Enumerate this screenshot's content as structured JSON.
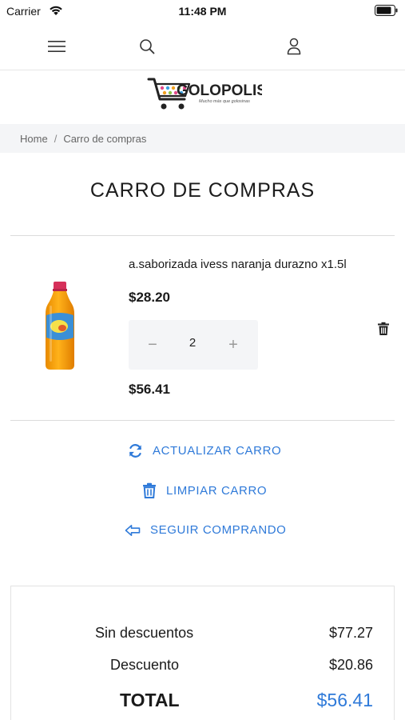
{
  "status_bar": {
    "carrier": "Carrier",
    "time": "11:48 PM"
  },
  "nav": {
    "menu_icon": "hamburger-menu-icon",
    "search_icon": "search-icon",
    "user_icon": "user-icon"
  },
  "brand": {
    "name": "GOLOPOLIS",
    "tagline": "Mucho más que golosinas"
  },
  "breadcrumb": {
    "home": "Home",
    "separator": "/",
    "current": "Carro de compras"
  },
  "page": {
    "title": "CARRO DE COMPRAS"
  },
  "cart_items": [
    {
      "name": "a.saborizada ivess naranja durazno x1.5l",
      "price": "$28.20",
      "quantity": "2",
      "minus": "−",
      "plus": "+",
      "subtotal": "$56.41"
    }
  ],
  "actions": {
    "update_cart": "ACTUALIZAR CARRO",
    "clear_cart": "LIMPIAR CARRO",
    "continue_shopping": "SEGUIR COMPRANDO"
  },
  "totals": {
    "without_discount_label": "Sin descuentos",
    "without_discount_value": "$77.27",
    "discount_label": "Descuento",
    "discount_value": "$20.86",
    "total_label": "TOTAL",
    "total_value": "$56.41"
  },
  "colors": {
    "accent": "#2f7ad9",
    "breadcrumb_bg": "#f4f5f7",
    "qty_bg": "#f4f5f7"
  }
}
